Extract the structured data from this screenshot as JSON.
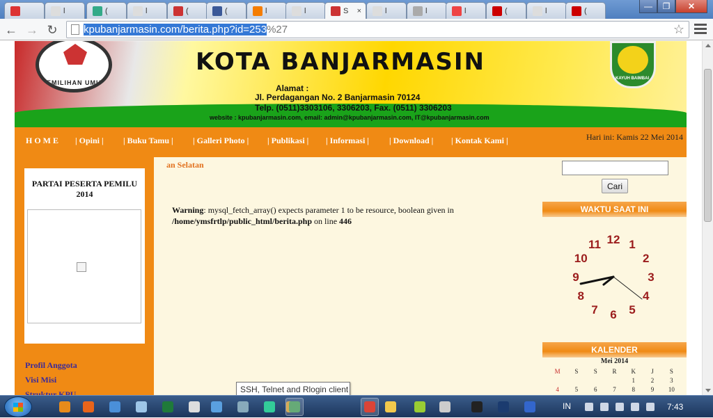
{
  "browser": {
    "tabs": [
      {
        "title": "",
        "icon": "red-circle-icon",
        "color": "#d33"
      },
      {
        "title": "l",
        "icon": "page-icon",
        "color": "#ddd"
      },
      {
        "title": "(",
        "icon": "globe-icon",
        "color": "#3a8"
      },
      {
        "title": "l",
        "icon": "page-icon",
        "color": "#ddd"
      },
      {
        "title": "(",
        "icon": "logo-icon",
        "color": "#c33"
      },
      {
        "title": "(",
        "icon": "facebook-icon",
        "color": "#3b5998"
      },
      {
        "title": "l",
        "icon": "blogger-icon",
        "color": "#f57d00"
      },
      {
        "title": "l",
        "icon": "image-icon",
        "color": "#ddd"
      },
      {
        "title": "S",
        "icon": "kpu-icon",
        "color": "#c33"
      },
      {
        "title": "l",
        "icon": "page-icon",
        "color": "#ddd"
      },
      {
        "title": "l",
        "icon": "cart-icon",
        "color": "#aaa"
      },
      {
        "title": "l",
        "icon": "warning-icon",
        "color": "#e44"
      },
      {
        "title": "(",
        "icon": "h-icon",
        "color": "#c00"
      },
      {
        "title": "l",
        "icon": "page-icon",
        "color": "#ddd"
      },
      {
        "title": "(",
        "icon": "h-icon",
        "color": "#c00"
      }
    ],
    "url_selected": "kpubanjarmasin.com/berita.php?id=253",
    "url_rest": "%27"
  },
  "site": {
    "title": "KOTA BANJARMASIN",
    "seal_text": "PEMILIHAN UMUM",
    "seal2_text": "KAYUH BAIMBAI",
    "alamat_label": "Alamat :",
    "address": "Jl. Perdagangan No. 2 Banjarmasin 70124",
    "phone": "Telp. (0511)3303106, 3306203, Fax. (0511) 3306203",
    "website": "website : kpubanjarmasin.com, email: admin@kpubanjarmasin.com, IT@kpubanjarmasin.com",
    "nav": [
      "H O M E",
      "| Opini |",
      "| Buku Tamu |",
      "| Galleri Photo |",
      "| Publikasi |",
      "| Informasi |",
      "| Download |",
      "| Kontak Kami |"
    ],
    "date": "Hari ini: Kamis 22 Mei 2014",
    "left": {
      "box_title": "PARTAI PESERTA PEMILU 2014",
      "links": [
        "Profil Anggota",
        "Visi Misi",
        "Struktur KPU"
      ]
    },
    "main": {
      "kicker": "an Selatan",
      "warning_label": "Warning",
      "warning_text": ": mysql_fetch_array() expects parameter 1 to be resource, boolean given in",
      "warning_path": "/home/ymsfrtlp/public_html/berita.php",
      "warning_on": " on line ",
      "warning_line": "446"
    },
    "right": {
      "search_button": "Cari",
      "clock_title": "WAKTU SAAT INI",
      "clock_numbers": [
        "12",
        "1",
        "2",
        "3",
        "4",
        "5",
        "6",
        "7",
        "8",
        "9",
        "10",
        "11"
      ],
      "calendar_title": "KALENDER",
      "calendar_month": "Mei 2014",
      "weekdays": [
        "M",
        "S",
        "S",
        "R",
        "K",
        "J",
        "S"
      ],
      "weeks": [
        [
          "",
          "",
          "",
          "",
          "1",
          "2",
          "3"
        ],
        [
          "4",
          "5",
          "6",
          "7",
          "8",
          "9",
          "10"
        ]
      ]
    }
  },
  "tooltip": "SSH, Telnet and Rlogin client",
  "taskbar": {
    "lang": "IN",
    "time": "7:43"
  }
}
